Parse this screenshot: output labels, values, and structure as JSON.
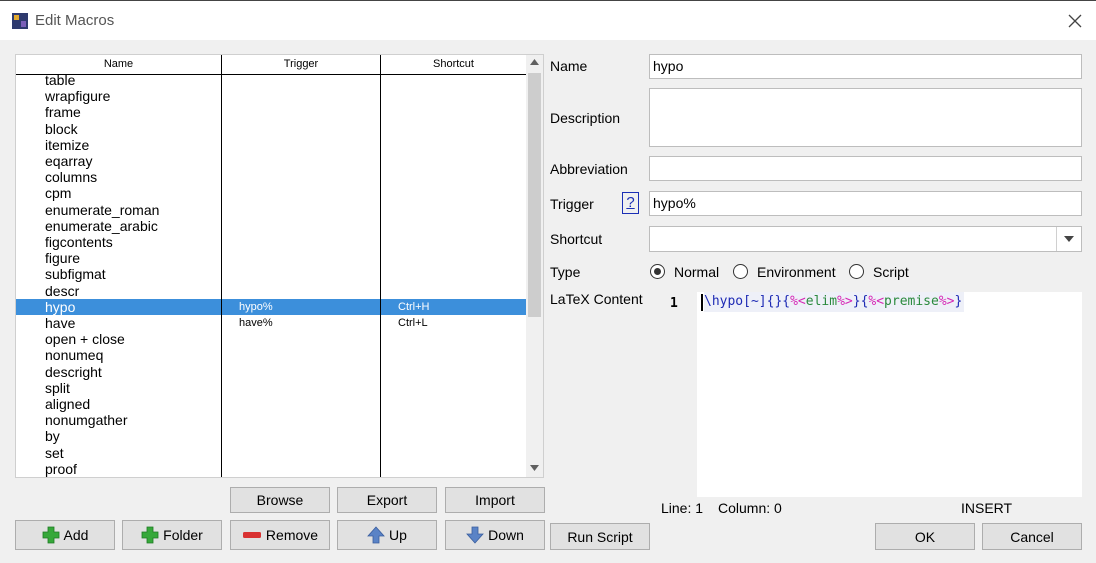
{
  "window": {
    "title": "Edit Macros"
  },
  "list": {
    "headers": {
      "name": "Name",
      "trigger": "Trigger",
      "shortcut": "Shortcut"
    },
    "rows": [
      {
        "name": "table",
        "trigger": "",
        "shortcut": ""
      },
      {
        "name": "wrapfigure",
        "trigger": "",
        "shortcut": ""
      },
      {
        "name": "frame",
        "trigger": "",
        "shortcut": ""
      },
      {
        "name": "block",
        "trigger": "",
        "shortcut": ""
      },
      {
        "name": "itemize",
        "trigger": "",
        "shortcut": ""
      },
      {
        "name": "eqarray",
        "trigger": "",
        "shortcut": ""
      },
      {
        "name": "columns",
        "trigger": "",
        "shortcut": ""
      },
      {
        "name": "cpm",
        "trigger": "",
        "shortcut": ""
      },
      {
        "name": "enumerate_roman",
        "trigger": "",
        "shortcut": ""
      },
      {
        "name": "enumerate_arabic",
        "trigger": "",
        "shortcut": ""
      },
      {
        "name": "figcontents",
        "trigger": "",
        "shortcut": ""
      },
      {
        "name": "figure",
        "trigger": "",
        "shortcut": ""
      },
      {
        "name": "subfigmat",
        "trigger": "",
        "shortcut": ""
      },
      {
        "name": "descr",
        "trigger": "",
        "shortcut": ""
      },
      {
        "name": "hypo",
        "trigger": "hypo%",
        "shortcut": "Ctrl+H",
        "selected": true
      },
      {
        "name": "have",
        "trigger": "have%",
        "shortcut": "Ctrl+L"
      },
      {
        "name": "open + close",
        "trigger": "",
        "shortcut": ""
      },
      {
        "name": "nonumeq",
        "trigger": "",
        "shortcut": ""
      },
      {
        "name": "descright",
        "trigger": "",
        "shortcut": ""
      },
      {
        "name": "split",
        "trigger": "",
        "shortcut": ""
      },
      {
        "name": "aligned",
        "trigger": "",
        "shortcut": ""
      },
      {
        "name": "nonumgather",
        "trigger": "",
        "shortcut": ""
      },
      {
        "name": "by",
        "trigger": "",
        "shortcut": ""
      },
      {
        "name": "set",
        "trigger": "",
        "shortcut": ""
      },
      {
        "name": "proof",
        "trigger": "",
        "shortcut": ""
      }
    ]
  },
  "buttons": {
    "browse": "Browse",
    "export": "Export",
    "import": "Import",
    "add": "Add",
    "folder": "Folder",
    "remove": "Remove",
    "up": "Up",
    "down": "Down",
    "run_script": "Run Script",
    "ok": "OK",
    "cancel": "Cancel"
  },
  "form": {
    "name_label": "Name",
    "name_value": "hypo",
    "description_label": "Description",
    "description_value": "",
    "abbreviation_label": "Abbreviation",
    "abbreviation_value": "",
    "trigger_label": "Trigger",
    "trigger_help": "?",
    "trigger_value": "hypo%",
    "shortcut_label": "Shortcut",
    "shortcut_value": "",
    "type_label": "Type",
    "type_options": [
      "Normal",
      "Environment",
      "Script"
    ],
    "type_selected": "Normal",
    "content_label": "LaTeX Content"
  },
  "editor": {
    "line_number": "1",
    "code_parts": [
      "\\hypo",
      "[~]",
      "{}",
      "{",
      "%<",
      "elim",
      "%>",
      "}",
      "{",
      "%<",
      "premise",
      "%>",
      "}"
    ]
  },
  "status": {
    "line": "Line: 1",
    "column": "Column: 0",
    "mode": "INSERT"
  },
  "colors": {
    "selection": "#3c8fdb",
    "plus_icon": "#36a83a",
    "remove_icon": "#d93232",
    "arrow_icon": "#5a83c6"
  }
}
